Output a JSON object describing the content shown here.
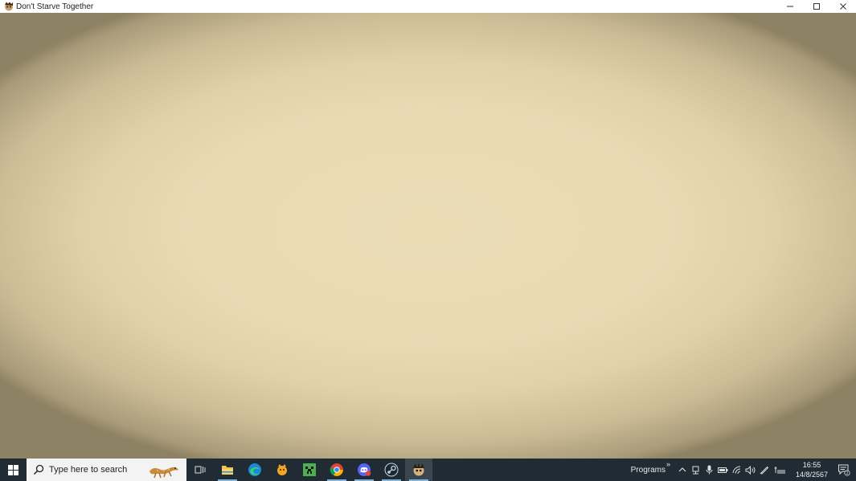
{
  "window": {
    "title": "Don't Starve Together",
    "controls": [
      "minimize",
      "maximize",
      "close"
    ]
  },
  "taskbar": {
    "search_placeholder": "Type here to search",
    "pinned": [
      {
        "name": "task-view-icon"
      },
      {
        "name": "file-explorer-icon",
        "active": true
      },
      {
        "name": "edge-icon"
      },
      {
        "name": "game-app-icon"
      },
      {
        "name": "minecraft-icon"
      },
      {
        "name": "chrome-icon",
        "active": true
      },
      {
        "name": "discord-icon",
        "active": true
      },
      {
        "name": "steam-icon",
        "active": true
      },
      {
        "name": "dont-starve-together-icon",
        "active": true,
        "current": true
      }
    ],
    "tray": {
      "programs_label": "Programs",
      "programs_chevron": "»",
      "time": "16:55",
      "date": "14/8/2567",
      "notification_count": "2"
    }
  },
  "colors": {
    "viewport_center": "#ebdcb6",
    "viewport_edge": "#8e8264",
    "taskbar": "#202b33",
    "accent": "#7fb3d8"
  }
}
